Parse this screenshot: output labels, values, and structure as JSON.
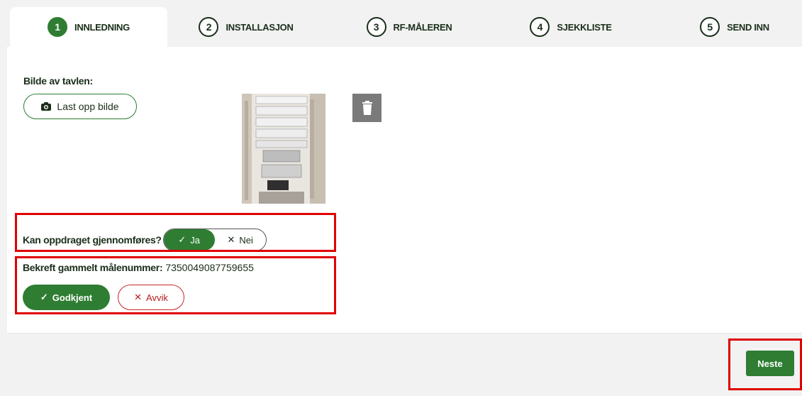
{
  "stepper": {
    "steps": [
      {
        "number": "1",
        "label": "INNLEDNING",
        "active": true
      },
      {
        "number": "2",
        "label": "INSTALLASJON",
        "active": false
      },
      {
        "number": "3",
        "label": "RF-MÅLEREN",
        "active": false
      },
      {
        "number": "4",
        "label": "SJEKKLISTE",
        "active": false
      },
      {
        "number": "5",
        "label": "SEND INN",
        "active": false
      }
    ]
  },
  "photo_section": {
    "title": "Bilde av tavlen:",
    "upload_label": "Last opp bilde",
    "upload_icon": "camera-icon",
    "delete_icon": "trash-icon"
  },
  "question": {
    "label": "Kan oppdraget gjennomføres?",
    "yes_label": "Ja",
    "no_label": "Nei",
    "selected": "Ja"
  },
  "confirm_meter": {
    "label": "Bekreft gammelt målenummer:",
    "value": "7350049087759655",
    "approve_label": "Godkjent",
    "deviation_label": "Avvik"
  },
  "footer": {
    "next_label": "Neste"
  },
  "colors": {
    "accent": "#2e7d32",
    "deviation": "#c62828",
    "highlight": "#e00000",
    "background": "#f2f2f2"
  }
}
